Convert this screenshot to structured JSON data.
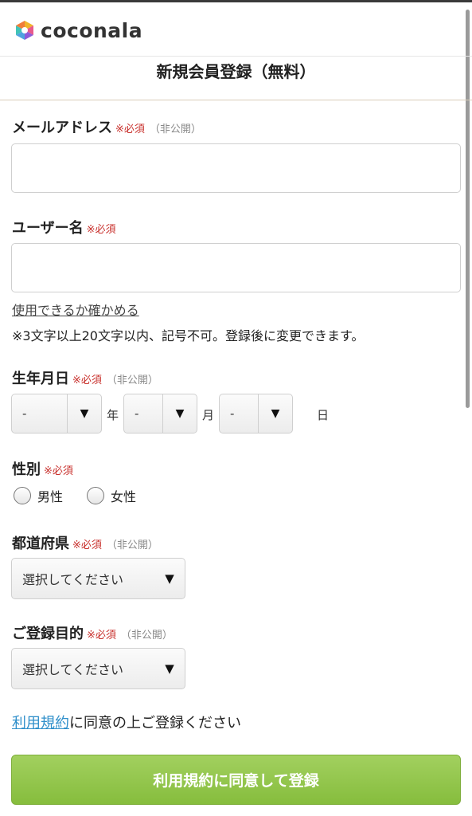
{
  "brand": {
    "name": "coconala"
  },
  "page": {
    "title": "新規会員登録（無料）"
  },
  "required_mark": "※必須",
  "private_mark": "（非公開）",
  "fields": {
    "email": {
      "label": "メールアドレス",
      "value": "",
      "placeholder": ""
    },
    "username": {
      "label": "ユーザー名",
      "value": "",
      "placeholder": "",
      "check_link": "使用できるか確かめる",
      "note": "※3文字以上20文字以内、記号不可。登録後に変更できます。"
    },
    "birthday": {
      "label": "生年月日",
      "year": {
        "value": "-",
        "unit": "年"
      },
      "month": {
        "value": "-",
        "unit": "月"
      },
      "day": {
        "value": "-",
        "unit": "日"
      }
    },
    "gender": {
      "label": "性別",
      "options": [
        "男性",
        "女性"
      ]
    },
    "prefecture": {
      "label": "都道府県",
      "value": "選択してください"
    },
    "purpose": {
      "label": "ご登録目的",
      "value": "選択してください"
    }
  },
  "terms": {
    "link": "利用規約",
    "text": "に同意の上ご登録ください"
  },
  "submit": {
    "label": "利用規約に同意して登録"
  },
  "icons": {
    "logo": "coconala-logo-icon",
    "dropdown": "caret-down-icon",
    "radio": "radio-icon"
  },
  "colors": {
    "required": "#c8302c",
    "link": "#2f8fca",
    "submit": "#8fc448"
  }
}
